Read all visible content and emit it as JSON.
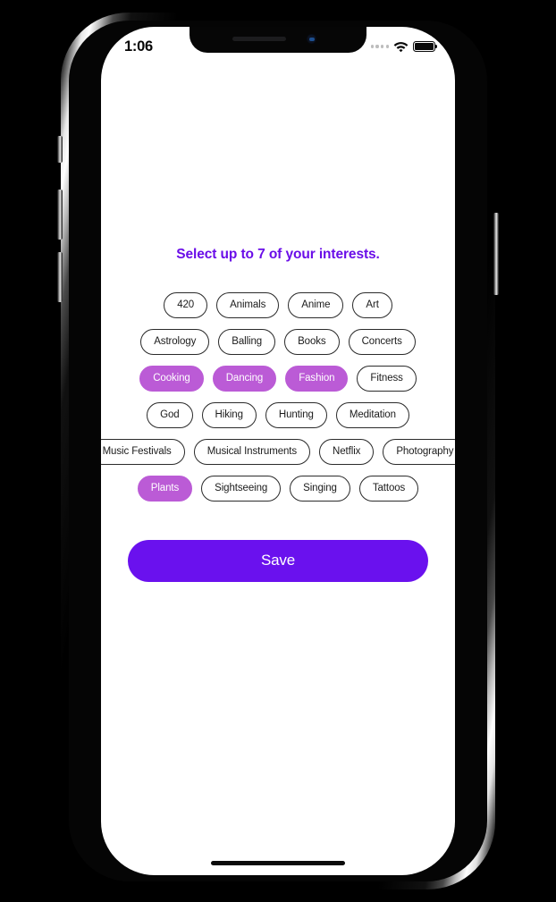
{
  "device": {
    "status_bar": {
      "time": "1:06",
      "signal_icon": "signal-dots-icon",
      "wifi_icon": "wifi-icon",
      "battery_icon": "battery-full-icon"
    },
    "home_indicator": "home-indicator"
  },
  "screen": {
    "title": "Select up to 7 of your interests.",
    "title_color": "#6A0DE8",
    "selected_chip_color": "#BB5BD6",
    "save_button_color": "#6A11EE",
    "interest_rows": [
      [
        {
          "label": "420",
          "selected": false
        },
        {
          "label": "Animals",
          "selected": false
        },
        {
          "label": "Anime",
          "selected": false
        },
        {
          "label": "Art",
          "selected": false
        }
      ],
      [
        {
          "label": "Astrology",
          "selected": false
        },
        {
          "label": "Balling",
          "selected": false
        },
        {
          "label": "Books",
          "selected": false
        },
        {
          "label": "Concerts",
          "selected": false
        }
      ],
      [
        {
          "label": "Cooking",
          "selected": true
        },
        {
          "label": "Dancing",
          "selected": true
        },
        {
          "label": "Fashion",
          "selected": true
        },
        {
          "label": "Fitness",
          "selected": false
        }
      ],
      [
        {
          "label": "God",
          "selected": false
        },
        {
          "label": "Hiking",
          "selected": false
        },
        {
          "label": "Hunting",
          "selected": false
        },
        {
          "label": "Meditation",
          "selected": false
        }
      ],
      [
        {
          "label": "Music Festivals",
          "selected": false
        },
        {
          "label": "Musical Instruments",
          "selected": false
        },
        {
          "label": "Netflix",
          "selected": false
        },
        {
          "label": "Photography",
          "selected": false
        }
      ],
      [
        {
          "label": "Plants",
          "selected": true
        },
        {
          "label": "Sightseeing",
          "selected": false
        },
        {
          "label": "Singing",
          "selected": false
        },
        {
          "label": "Tattoos",
          "selected": false
        }
      ]
    ],
    "save_label": "Save"
  }
}
